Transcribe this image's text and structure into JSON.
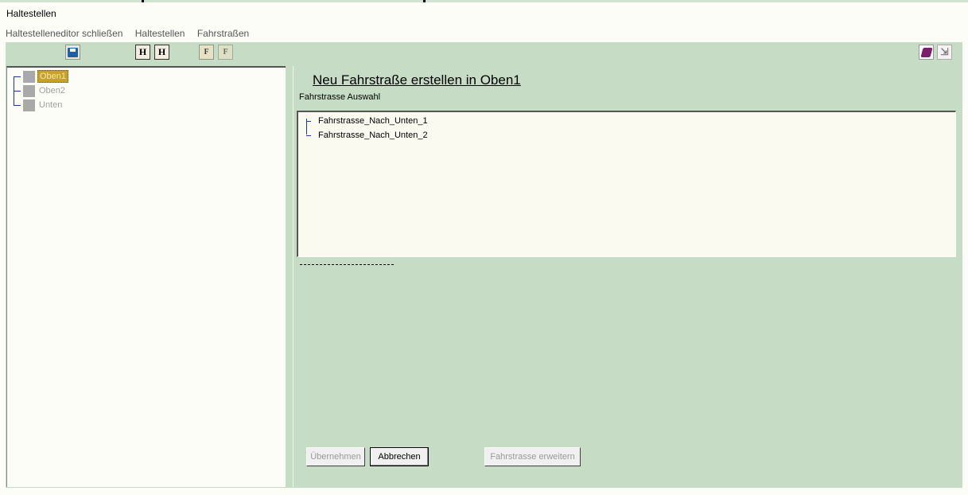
{
  "app": {
    "title": "Haltestellen"
  },
  "menu": {
    "items": [
      "Haltestelleneditor schließen",
      "Haltestellen",
      "Fahrstraßen"
    ]
  },
  "toolbar": {
    "buttons": {
      "save_icon": "floppy-disk-icon",
      "h1_label": "H",
      "h2_label": "H",
      "f1_label": "F",
      "f2_label": "F",
      "book_icon": "book-icon",
      "exit_icon": "exit-icon"
    }
  },
  "tree": {
    "items": [
      {
        "label": "Oben1",
        "selected": true
      },
      {
        "label": "Oben2",
        "selected": false
      },
      {
        "label": "Unten",
        "selected": false
      }
    ]
  },
  "panel": {
    "title": "Neu Fahrstraße erstellen in Oben1",
    "subtitle": "Fahrstrasse Auswahl",
    "list": {
      "items": [
        "Fahrstrasse_Nach_Unten_1",
        "Fahrstrasse_Nach_Unten_2"
      ]
    },
    "buttons": {
      "apply": "Übernehmen",
      "cancel": "Abbrechen",
      "extend": "Fahrstrasse erweitern"
    }
  },
  "colors": {
    "panel_bg": "#c6dcc4",
    "selected_node": "#c8a228",
    "tree_lines": "#1a3a9a"
  }
}
